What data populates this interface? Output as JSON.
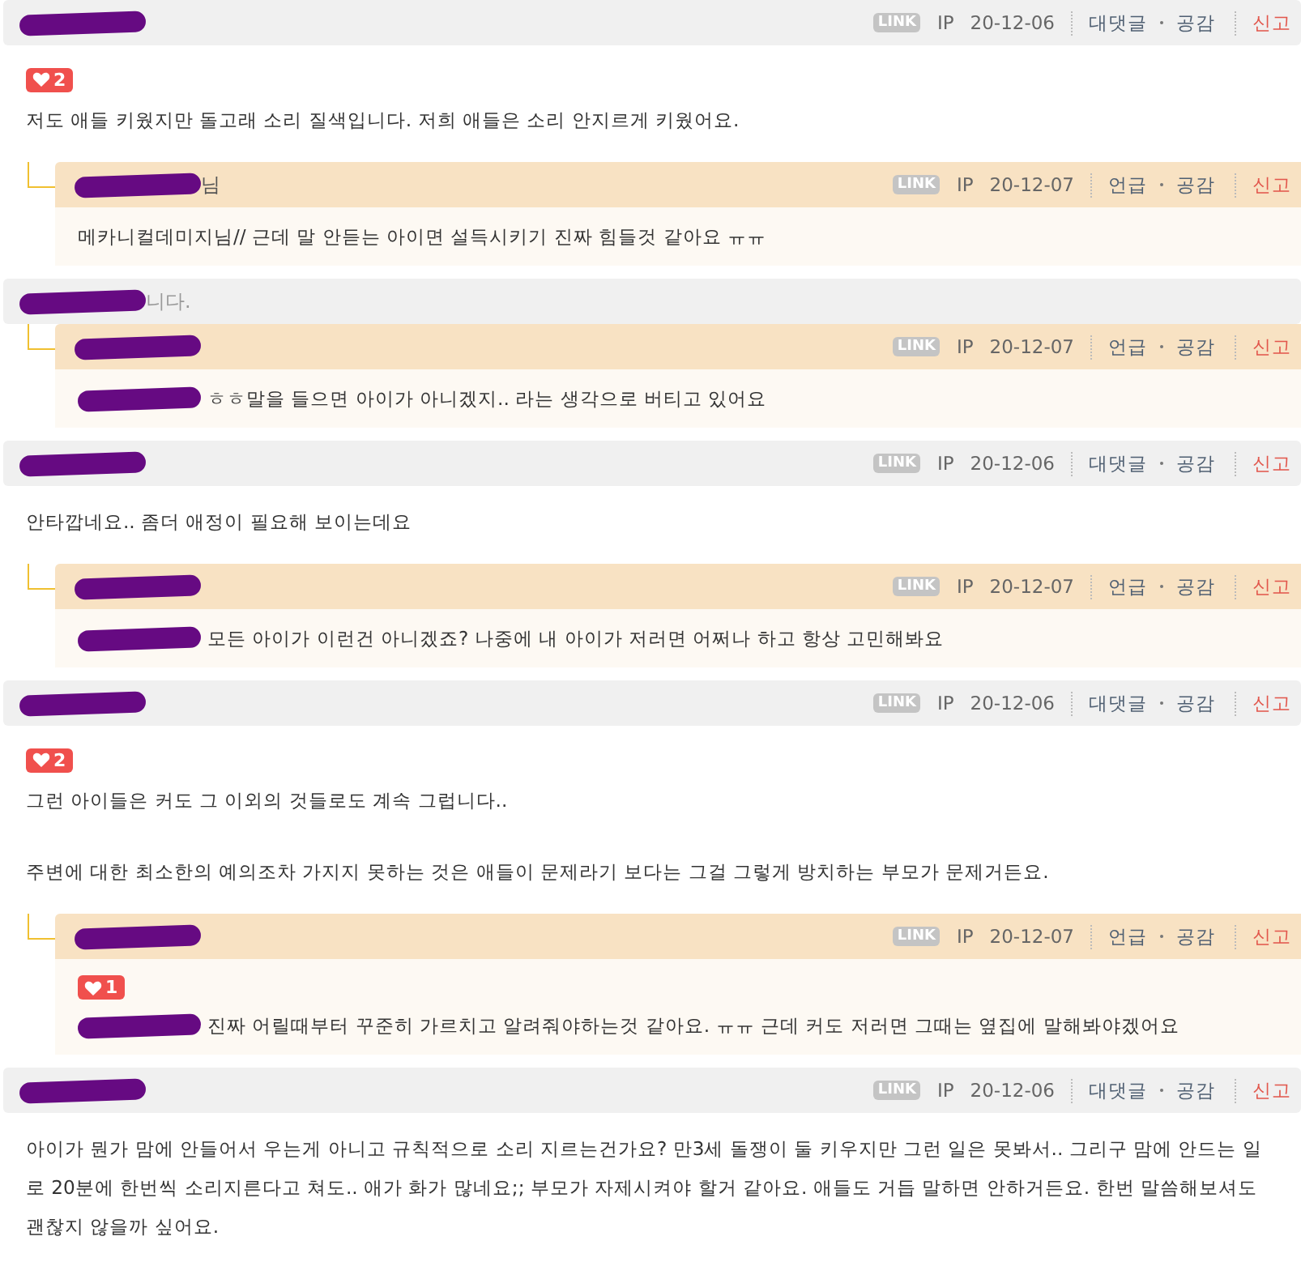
{
  "comments": [
    {
      "kind": "comment",
      "redacted": true,
      "link": "LINK",
      "ip": "IP",
      "date": "20-12-06",
      "actions": [
        {
          "kind": "reply",
          "label": "대댓글"
        },
        {
          "kind": "like",
          "label": "공감"
        },
        {
          "kind": "report",
          "label": "신고"
        }
      ],
      "likes": "2",
      "paragraphs": [
        "저도 애들 키웠지만 돌고래 소리 질색입니다. 저희 애들은 소리 안지르게 키웠어요."
      ],
      "replies": [
        {
          "redacted": true,
          "name_tail": "님",
          "link": "LINK",
          "ip": "IP",
          "date": "20-12-07",
          "actions": [
            {
              "kind": "reply",
              "label": "언급"
            },
            {
              "kind": "like",
              "label": "공감"
            },
            {
              "kind": "report",
              "label": "신고"
            }
          ],
          "body_redacted": false,
          "body": "메카니컬데미지님// 근데 말 안듣는 아이면 설득시키기 진짜 힘들것 같아요 ㅠㅠ"
        }
      ]
    },
    {
      "kind": "deleted",
      "redacted": true,
      "text": "니다.",
      "replies": [
        {
          "redacted": true,
          "link": "LINK",
          "ip": "IP",
          "date": "20-12-07",
          "actions": [
            {
              "kind": "reply",
              "label": "언급"
            },
            {
              "kind": "like",
              "label": "공감"
            },
            {
              "kind": "report",
              "label": "신고"
            }
          ],
          "body_redacted": true,
          "body": "ㅎㅎ말을 들으면 아이가 아니겠지.. 라는 생각으로 버티고 있어요"
        }
      ]
    },
    {
      "kind": "comment",
      "redacted": true,
      "link": "LINK",
      "ip": "IP",
      "date": "20-12-06",
      "actions": [
        {
          "kind": "reply",
          "label": "대댓글"
        },
        {
          "kind": "like",
          "label": "공감"
        },
        {
          "kind": "report",
          "label": "신고"
        }
      ],
      "paragraphs": [
        "안타깝네요.. 좀더 애정이 필요해 보이는데요"
      ],
      "replies": [
        {
          "redacted": true,
          "link": "LINK",
          "ip": "IP",
          "date": "20-12-07",
          "actions": [
            {
              "kind": "reply",
              "label": "언급"
            },
            {
              "kind": "like",
              "label": "공감"
            },
            {
              "kind": "report",
              "label": "신고"
            }
          ],
          "body_redacted": true,
          "body": "모든 아이가 이런건 아니겠죠? 나중에 내 아이가 저러면 어쩌나 하고 항상 고민해봐요"
        }
      ]
    },
    {
      "kind": "comment",
      "redacted": true,
      "link": "LINK",
      "ip": "IP",
      "date": "20-12-06",
      "actions": [
        {
          "kind": "reply",
          "label": "대댓글"
        },
        {
          "kind": "like",
          "label": "공감"
        },
        {
          "kind": "report",
          "label": "신고"
        }
      ],
      "likes": "2",
      "paragraphs": [
        "그런 아이들은 커도 그 이외의 것들로도 계속 그럽니다..",
        "주변에 대한 최소한의 예의조차 가지지 못하는 것은 애들이 문제라기 보다는 그걸 그렇게 방치하는 부모가 문제거든요."
      ],
      "replies": [
        {
          "redacted": true,
          "link": "LINK",
          "ip": "IP",
          "date": "20-12-07",
          "actions": [
            {
              "kind": "reply",
              "label": "언급"
            },
            {
              "kind": "like",
              "label": "공감"
            },
            {
              "kind": "report",
              "label": "신고"
            }
          ],
          "likes": "1",
          "body_redacted": true,
          "body": "진짜 어릴때부터 꾸준히 가르치고 알려줘야하는것 같아요. ㅠㅠ 근데 커도 저러면 그때는 옆집에 말해봐야겠어요"
        }
      ]
    },
    {
      "kind": "comment",
      "redacted": true,
      "link": "LINK",
      "ip": "IP",
      "date": "20-12-06",
      "actions": [
        {
          "kind": "reply",
          "label": "대댓글"
        },
        {
          "kind": "like",
          "label": "공감"
        },
        {
          "kind": "report",
          "label": "신고"
        }
      ],
      "paragraphs": [
        "아이가 뭔가 맘에 안들어서 우는게 아니고 규칙적으로 소리 지르는건가요? 만3세 돌쟁이 둘 키우지만 그런 일은 못봐서.. 그리구 맘에 안드는 일로 20분에 한번씩 소리지른다고 쳐도.. 애가 화가 많네요;; 부모가 자제시켜야 할거 같아요. 애들도 거듭 말하면 안하거든요. 한번 말씀해보셔도 괜찮지 않을까 싶어요."
      ]
    }
  ]
}
